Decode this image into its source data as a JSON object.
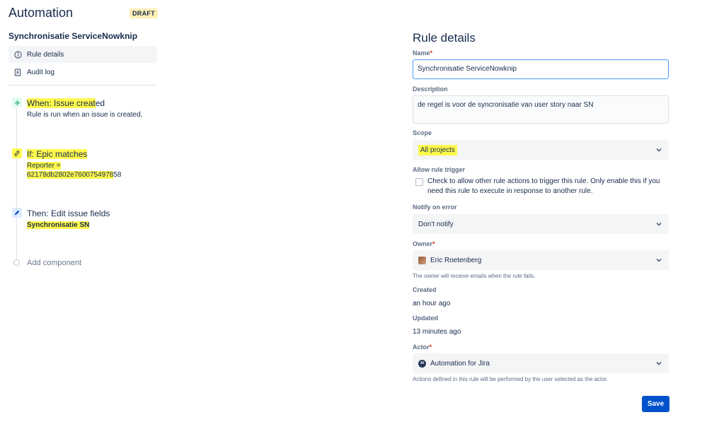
{
  "app": {
    "title": "Automation",
    "badge": "DRAFT"
  },
  "rule": {
    "name": "Synchronisatie ServiceNowknip"
  },
  "nav": [
    {
      "label": "Rule details",
      "icon": "info-icon",
      "active": true
    },
    {
      "label": "Audit log",
      "icon": "document-icon",
      "active": false
    }
  ],
  "steps": [
    {
      "prefix": "When: ",
      "title": "Issue created",
      "title_hl": "When: Issue creat",
      "title_rest": "ed",
      "sub": "Rule is run when an issue is created.",
      "icon": "plus-icon"
    },
    {
      "title": "If: Epic matches",
      "sub_line1": "Reporter =",
      "sub_line2_hl": "62178db2802e7600754978",
      "sub_line2_rest": "58",
      "icon": "link-icon"
    },
    {
      "title": "Then: Edit issue fields",
      "sub": "Synchronisatie SN",
      "icon": "pencil-icon"
    }
  ],
  "add_component": "Add component",
  "details": {
    "title": "Rule details",
    "name_label": "Name",
    "name_value": "Synchronisatie ServiceNowknip",
    "description_label": "Description",
    "description_value": "de regel is voor de syncronisatie van user story naar SN",
    "scope_label": "Scope",
    "scope_value": "All projects",
    "allow_label": "Allow rule trigger",
    "allow_text": "Check to allow other rule actions to trigger this rule. Only enable this if you need this rule to execute in response to another rule.",
    "notify_label": "Notify on error",
    "notify_value": "Don't notify",
    "owner_label": "Owner",
    "owner_value": "Eric Roetenberg",
    "owner_help": "The owner will receive emails when the rule fails.",
    "created_label": "Created",
    "created_value": "an hour ago",
    "updated_label": "Updated",
    "updated_value": "13 minutes ago",
    "actor_label": "Actor",
    "actor_value": "Automation for Jira",
    "actor_avatar_text": "AI",
    "actor_help": "Actions defined in this rule will be performed by the user selected as the actor.",
    "required_mark": "*",
    "save_label": "Save"
  },
  "colors": {
    "primary": "#0052cc",
    "highlight": "#fff94d",
    "required": "#de350b"
  }
}
